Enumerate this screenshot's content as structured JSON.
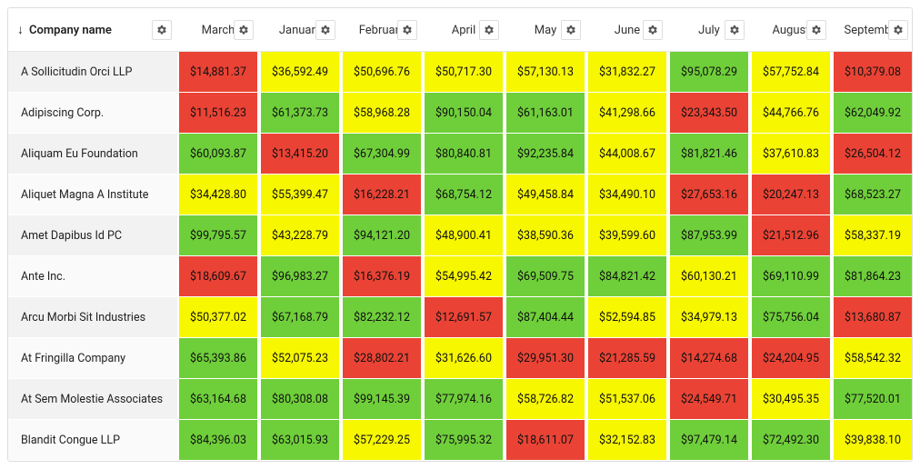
{
  "header": {
    "company_label": "Company name",
    "sort_indicator": "↓",
    "months": [
      "March",
      "January",
      "February",
      "April",
      "May",
      "June",
      "July",
      "August",
      "September"
    ]
  },
  "colors": {
    "red": "#ea4335",
    "yellow": "#f7f700",
    "green": "#6fcf3a"
  },
  "rows": [
    {
      "name": "A Sollicitudin Orci LLP",
      "cells": [
        {
          "v": "$14,881.37",
          "c": "red"
        },
        {
          "v": "$36,592.49",
          "c": "yellow"
        },
        {
          "v": "$50,696.76",
          "c": "yellow"
        },
        {
          "v": "$50,717.30",
          "c": "yellow"
        },
        {
          "v": "$57,130.13",
          "c": "yellow"
        },
        {
          "v": "$31,832.27",
          "c": "yellow"
        },
        {
          "v": "$95,078.29",
          "c": "green"
        },
        {
          "v": "$57,752.84",
          "c": "yellow"
        },
        {
          "v": "$10,379.08",
          "c": "red"
        }
      ]
    },
    {
      "name": "Adipiscing Corp.",
      "cells": [
        {
          "v": "$11,516.23",
          "c": "red"
        },
        {
          "v": "$61,373.73",
          "c": "green"
        },
        {
          "v": "$58,968.28",
          "c": "yellow"
        },
        {
          "v": "$90,150.04",
          "c": "green"
        },
        {
          "v": "$61,163.01",
          "c": "green"
        },
        {
          "v": "$41,298.66",
          "c": "yellow"
        },
        {
          "v": "$23,343.50",
          "c": "red"
        },
        {
          "v": "$44,766.76",
          "c": "yellow"
        },
        {
          "v": "$62,049.92",
          "c": "green"
        }
      ]
    },
    {
      "name": "Aliquam Eu Foundation",
      "cells": [
        {
          "v": "$60,093.87",
          "c": "green"
        },
        {
          "v": "$13,415.20",
          "c": "red"
        },
        {
          "v": "$67,304.99",
          "c": "green"
        },
        {
          "v": "$80,840.81",
          "c": "green"
        },
        {
          "v": "$92,235.84",
          "c": "green"
        },
        {
          "v": "$44,008.67",
          "c": "yellow"
        },
        {
          "v": "$81,821.46",
          "c": "green"
        },
        {
          "v": "$37,610.83",
          "c": "yellow"
        },
        {
          "v": "$26,504.12",
          "c": "red"
        }
      ]
    },
    {
      "name": "Aliquet Magna A Institute",
      "cells": [
        {
          "v": "$34,428.80",
          "c": "yellow"
        },
        {
          "v": "$55,399.47",
          "c": "yellow"
        },
        {
          "v": "$16,228.21",
          "c": "red"
        },
        {
          "v": "$68,754.12",
          "c": "green"
        },
        {
          "v": "$49,458.84",
          "c": "yellow"
        },
        {
          "v": "$34,490.10",
          "c": "yellow"
        },
        {
          "v": "$27,653.16",
          "c": "red"
        },
        {
          "v": "$20,247.13",
          "c": "red"
        },
        {
          "v": "$68,523.27",
          "c": "green"
        }
      ]
    },
    {
      "name": "Amet Dapibus Id PC",
      "cells": [
        {
          "v": "$99,795.57",
          "c": "green"
        },
        {
          "v": "$43,228.79",
          "c": "yellow"
        },
        {
          "v": "$94,121.20",
          "c": "green"
        },
        {
          "v": "$48,900.41",
          "c": "yellow"
        },
        {
          "v": "$38,590.36",
          "c": "yellow"
        },
        {
          "v": "$39,599.60",
          "c": "yellow"
        },
        {
          "v": "$87,953.99",
          "c": "green"
        },
        {
          "v": "$21,512.96",
          "c": "red"
        },
        {
          "v": "$58,337.19",
          "c": "yellow"
        }
      ]
    },
    {
      "name": "Ante Inc.",
      "cells": [
        {
          "v": "$18,609.67",
          "c": "red"
        },
        {
          "v": "$96,983.27",
          "c": "green"
        },
        {
          "v": "$16,376.19",
          "c": "red"
        },
        {
          "v": "$54,995.42",
          "c": "yellow"
        },
        {
          "v": "$69,509.75",
          "c": "green"
        },
        {
          "v": "$84,821.42",
          "c": "green"
        },
        {
          "v": "$60,130.21",
          "c": "yellow"
        },
        {
          "v": "$69,110.99",
          "c": "green"
        },
        {
          "v": "$81,864.23",
          "c": "green"
        }
      ]
    },
    {
      "name": "Arcu Morbi Sit Industries",
      "cells": [
        {
          "v": "$50,377.02",
          "c": "yellow"
        },
        {
          "v": "$67,168.79",
          "c": "green"
        },
        {
          "v": "$82,232.12",
          "c": "green"
        },
        {
          "v": "$12,691.57",
          "c": "red"
        },
        {
          "v": "$87,404.44",
          "c": "green"
        },
        {
          "v": "$52,594.85",
          "c": "yellow"
        },
        {
          "v": "$34,979.13",
          "c": "yellow"
        },
        {
          "v": "$75,756.04",
          "c": "green"
        },
        {
          "v": "$13,680.87",
          "c": "red"
        }
      ]
    },
    {
      "name": "At Fringilla Company",
      "cells": [
        {
          "v": "$65,393.86",
          "c": "green"
        },
        {
          "v": "$52,075.23",
          "c": "yellow"
        },
        {
          "v": "$28,802.21",
          "c": "red"
        },
        {
          "v": "$31,626.60",
          "c": "yellow"
        },
        {
          "v": "$29,951.30",
          "c": "red"
        },
        {
          "v": "$21,285.59",
          "c": "red"
        },
        {
          "v": "$14,274.68",
          "c": "red"
        },
        {
          "v": "$24,204.95",
          "c": "red"
        },
        {
          "v": "$58,542.32",
          "c": "yellow"
        }
      ]
    },
    {
      "name": "At Sem Molestie Associates",
      "cells": [
        {
          "v": "$63,164.68",
          "c": "green"
        },
        {
          "v": "$80,308.08",
          "c": "green"
        },
        {
          "v": "$99,145.39",
          "c": "green"
        },
        {
          "v": "$77,974.16",
          "c": "green"
        },
        {
          "v": "$58,726.82",
          "c": "yellow"
        },
        {
          "v": "$51,537.06",
          "c": "yellow"
        },
        {
          "v": "$24,549.71",
          "c": "red"
        },
        {
          "v": "$30,495.35",
          "c": "yellow"
        },
        {
          "v": "$77,520.01",
          "c": "green"
        }
      ]
    },
    {
      "name": "Blandit Congue LLP",
      "cells": [
        {
          "v": "$84,396.03",
          "c": "green"
        },
        {
          "v": "$63,015.93",
          "c": "green"
        },
        {
          "v": "$57,229.25",
          "c": "yellow"
        },
        {
          "v": "$75,995.32",
          "c": "green"
        },
        {
          "v": "$18,611.07",
          "c": "red"
        },
        {
          "v": "$32,152.83",
          "c": "yellow"
        },
        {
          "v": "$97,479.14",
          "c": "green"
        },
        {
          "v": "$72,492.30",
          "c": "green"
        },
        {
          "v": "$39,838.10",
          "c": "yellow"
        }
      ]
    }
  ]
}
